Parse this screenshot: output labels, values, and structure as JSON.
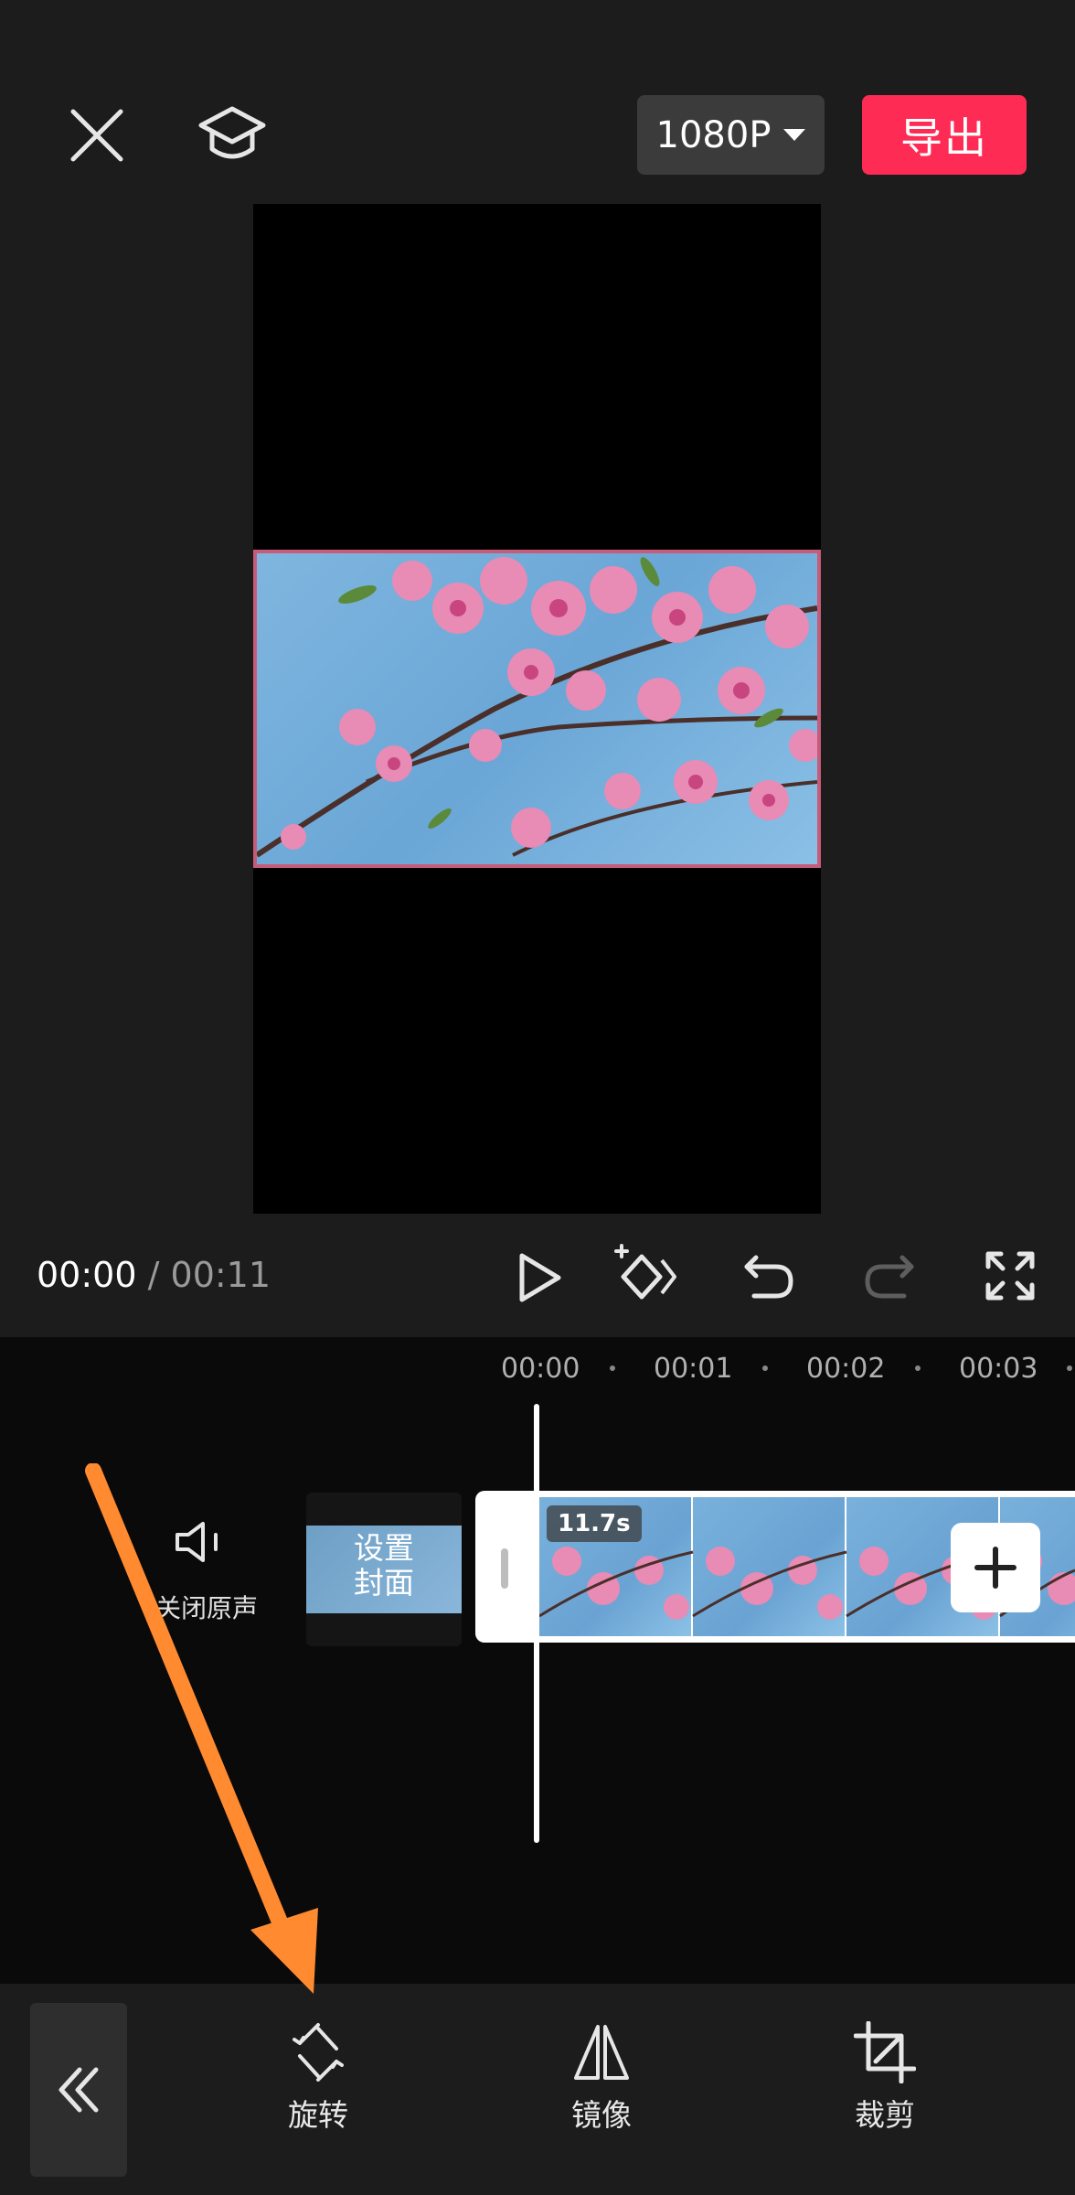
{
  "header": {
    "resolution_label": "1080P",
    "export_label": "导出"
  },
  "playback": {
    "current_time": "00:00",
    "separator": "/",
    "total_time": "00:11"
  },
  "timeline": {
    "ruler": [
      "00:00",
      "00:01",
      "00:02",
      "00:03"
    ],
    "mute_label": "关闭原声",
    "cover_label_line1": "设置",
    "cover_label_line2": "封面",
    "clip_duration": "11.7s"
  },
  "toolbar": {
    "items": [
      {
        "label": "旋转",
        "icon": "rotate-icon"
      },
      {
        "label": "镜像",
        "icon": "mirror-icon"
      },
      {
        "label": "裁剪",
        "icon": "crop-icon"
      }
    ]
  },
  "colors": {
    "export": "#fe2c55",
    "annotation_arrow": "#ff8a30",
    "background": "#1c1c1c"
  }
}
